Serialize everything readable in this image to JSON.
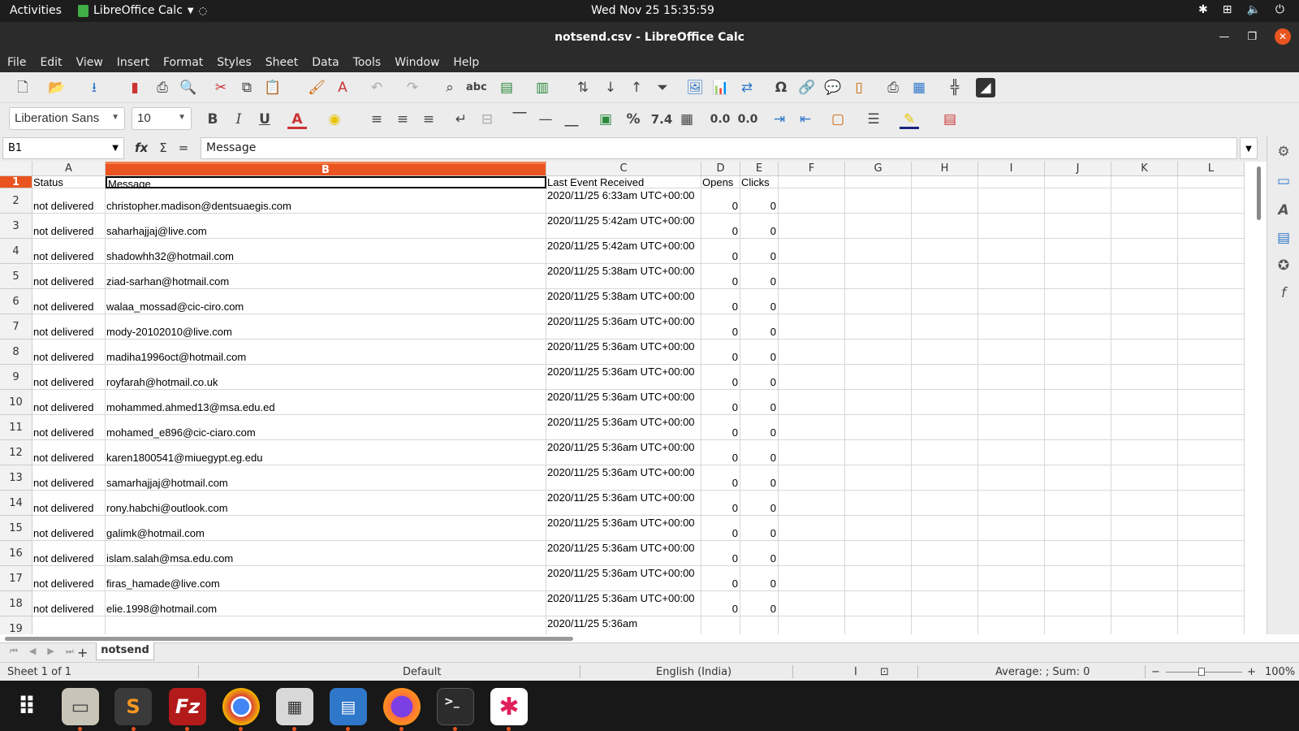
{
  "topbar": {
    "activities": "Activities",
    "app_name": "LibreOffice Calc",
    "clock": "Wed Nov 25  15:35:59"
  },
  "titlebar": {
    "title": "notsend.csv - LibreOffice Calc"
  },
  "menu": [
    "File",
    "Edit",
    "View",
    "Insert",
    "Format",
    "Styles",
    "Sheet",
    "Data",
    "Tools",
    "Window",
    "Help"
  ],
  "toolbar": {
    "font_name": "Liberation Sans",
    "font_size": "10",
    "percent_label": "%",
    "number_label": "7.4",
    "decimal_add_label": "0.0",
    "decimal_del_label": "0.0"
  },
  "formula": {
    "cell_ref": "B1",
    "content": "Message",
    "fx": "fx",
    "sigma": "Σ",
    "equals": "="
  },
  "columns": [
    "A",
    "B",
    "C",
    "D",
    "E",
    "F",
    "G",
    "H",
    "I",
    "J",
    "K",
    "L"
  ],
  "selected_column": "B",
  "rows": [
    {
      "n": "1",
      "a": "Status",
      "b": "Message",
      "c": "Last Event Received",
      "d": "Opens",
      "e": "Clicks",
      "header": true
    },
    {
      "n": "2",
      "a": "not delivered",
      "b": "christopher.madison@dentsuaegis.com",
      "c": "2020/11/25 6:33am UTC+00:00",
      "d": "0",
      "e": "0"
    },
    {
      "n": "3",
      "a": "not delivered",
      "b": "saharhajjaj@live.com",
      "c": "2020/11/25 5:42am UTC+00:00",
      "d": "0",
      "e": "0"
    },
    {
      "n": "4",
      "a": "not delivered",
      "b": "shadowhh32@hotmail.com",
      "c": "2020/11/25 5:42am UTC+00:00",
      "d": "0",
      "e": "0"
    },
    {
      "n": "5",
      "a": "not delivered",
      "b": "ziad-sarhan@hotmail.com",
      "c": "2020/11/25 5:38am UTC+00:00",
      "d": "0",
      "e": "0"
    },
    {
      "n": "6",
      "a": "not delivered",
      "b": "walaa_mossad@cic-ciro.com",
      "c": "2020/11/25 5:38am UTC+00:00",
      "d": "0",
      "e": "0"
    },
    {
      "n": "7",
      "a": "not delivered",
      "b": "mody-20102010@live.com",
      "c": "2020/11/25 5:36am UTC+00:00",
      "d": "0",
      "e": "0"
    },
    {
      "n": "8",
      "a": "not delivered",
      "b": "madiha1996oct@hotmail.com",
      "c": "2020/11/25 5:36am UTC+00:00",
      "d": "0",
      "e": "0"
    },
    {
      "n": "9",
      "a": "not delivered",
      "b": "royfarah@hotmail.co.uk",
      "c": "2020/11/25 5:36am UTC+00:00",
      "d": "0",
      "e": "0"
    },
    {
      "n": "10",
      "a": "not delivered",
      "b": "mohammed.ahmed13@msa.edu.ed",
      "c": "2020/11/25 5:36am UTC+00:00",
      "d": "0",
      "e": "0"
    },
    {
      "n": "11",
      "a": "not delivered",
      "b": "mohamed_e896@cic-ciaro.com",
      "c": "2020/11/25 5:36am UTC+00:00",
      "d": "0",
      "e": "0"
    },
    {
      "n": "12",
      "a": "not delivered",
      "b": "karen1800541@miuegypt.eg.edu",
      "c": "2020/11/25 5:36am UTC+00:00",
      "d": "0",
      "e": "0"
    },
    {
      "n": "13",
      "a": "not delivered",
      "b": "samarhajjaj@hotmail.com",
      "c": "2020/11/25 5:36am UTC+00:00",
      "d": "0",
      "e": "0"
    },
    {
      "n": "14",
      "a": "not delivered",
      "b": "rony.habchi@outlook.com",
      "c": "2020/11/25 5:36am UTC+00:00",
      "d": "0",
      "e": "0"
    },
    {
      "n": "15",
      "a": "not delivered",
      "b": "galimk@hotmail.com",
      "c": "2020/11/25 5:36am UTC+00:00",
      "d": "0",
      "e": "0"
    },
    {
      "n": "16",
      "a": "not delivered",
      "b": "islam.salah@msa.edu.com",
      "c": "2020/11/25 5:36am UTC+00:00",
      "d": "0",
      "e": "0"
    },
    {
      "n": "17",
      "a": "not delivered",
      "b": "firas_hamade@live.com",
      "c": "2020/11/25 5:36am UTC+00:00",
      "d": "0",
      "e": "0"
    },
    {
      "n": "18",
      "a": "not delivered",
      "b": "elie.1998@hotmail.com",
      "c": "2020/11/25 5:36am UTC+00:00",
      "d": "0",
      "e": "0"
    },
    {
      "n": "19",
      "a": "",
      "b": "",
      "c": "2020/11/25 5:36am",
      "d": "",
      "e": ""
    }
  ],
  "sheet_tab": "notsend",
  "add_sheet": "+",
  "status": {
    "sheet": "Sheet 1 of 1",
    "style": "Default",
    "language": "English (India)",
    "summary": "Average: ; Sum: 0",
    "zoom": "100%",
    "zoom_minus": "−",
    "zoom_plus": "+"
  },
  "colors": {
    "accent": "#e95420",
    "chrome_dark": "#2b2b2b",
    "toolbar": "#ececec"
  },
  "icons": [
    "new-icon",
    "open-icon",
    "save-icon",
    "pdf-icon",
    "print-icon",
    "preview-icon",
    "cut-icon",
    "copy-icon",
    "paste-icon",
    "clone-icon",
    "clear-format-icon",
    "undo-icon",
    "redo-icon",
    "find-icon",
    "spellcheck-icon",
    "row-icon",
    "column-icon",
    "sort-icon",
    "sort-asc-icon",
    "sort-desc-icon",
    "autofilter-icon",
    "image-icon",
    "chart-icon",
    "pivot-icon",
    "special-char-icon",
    "hyperlink-icon",
    "comment-icon",
    "header-footer-icon",
    "print-area-icon",
    "freeze-icon",
    "split-icon",
    "draw-icon"
  ]
}
